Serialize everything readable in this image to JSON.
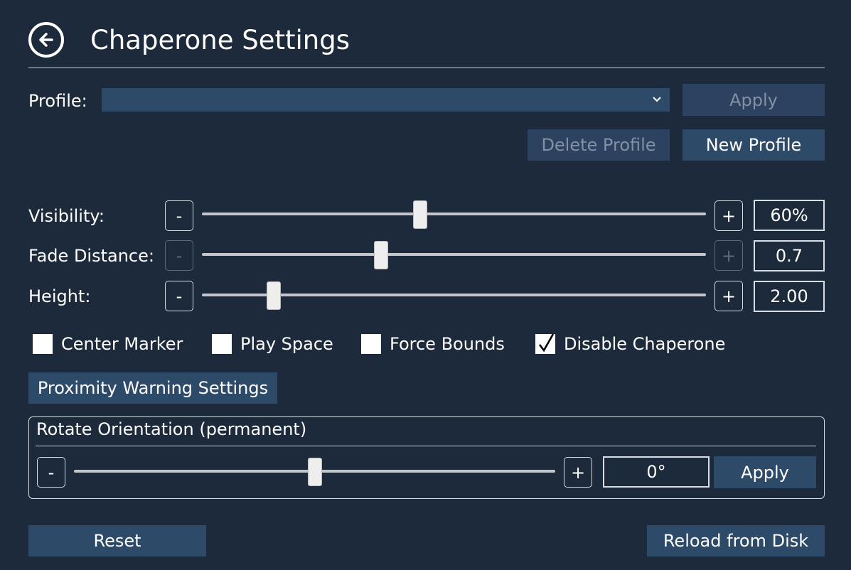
{
  "header": {
    "title": "Chaperone Settings",
    "back_icon": "arrow-left-circle-icon"
  },
  "profile": {
    "label": "Profile:",
    "selected": "",
    "apply_label": "Apply",
    "delete_label": "Delete Profile",
    "new_label": "New Profile"
  },
  "sliders": {
    "visibility": {
      "label": "Visibility:",
      "minus": "-",
      "plus": "+",
      "value_text": "60%",
      "position": 0.433
    },
    "fade_distance": {
      "label": "Fade Distance:",
      "minus": "-",
      "plus": "+",
      "value_text": "0.7",
      "position": 0.355
    },
    "height": {
      "label": "Height:",
      "minus": "-",
      "plus": "+",
      "value_text": "2.00",
      "position": 0.143
    }
  },
  "checkboxes": {
    "center_marker": {
      "label": "Center Marker",
      "checked": false
    },
    "play_space": {
      "label": "Play Space",
      "checked": false
    },
    "force_bounds": {
      "label": "Force Bounds",
      "checked": false
    },
    "disable_chaperone": {
      "label": "Disable Chaperone",
      "checked": true
    }
  },
  "proximity_button": "Proximity Warning Settings",
  "rotate": {
    "title": "Rotate Orientation (permanent)",
    "minus": "-",
    "plus": "+",
    "value_text": "0°",
    "position": 0.5,
    "apply_label": "Apply"
  },
  "footer": {
    "reset_label": "Reset",
    "reload_label": "Reload from Disk"
  },
  "colors": {
    "background": "#1c2a3b",
    "button": "#2e4a69",
    "disabled_text": "#8291a3"
  }
}
